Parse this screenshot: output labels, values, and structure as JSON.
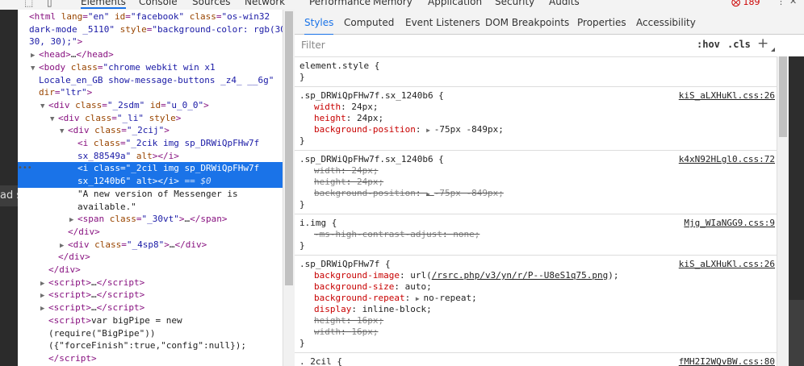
{
  "topbar": {
    "tabs": [
      "Elements",
      "Console",
      "Sources",
      "Network",
      "Performance",
      "Memory",
      "Application",
      "Security",
      "Audits"
    ],
    "active_tab": "Elements",
    "error_count": "189"
  },
  "behind_text": "ad s",
  "elements_tree": [
    {
      "indent": 0,
      "tri": "",
      "html": "<span class='tag'>&lt;html</span> <span class='an'>lang</span>=<span class='av'>\"en\"</span> <span class='an'>id</span>=<span class='av'>\"facebook\"</span> <span class='an'>class</span>=<span class='av'>\"os-win32</span>"
    },
    {
      "indent": 0,
      "tri": "",
      "html": "<span class='av'>dark-mode _5110\"</span> <span class='an'>style</span>=<span class='av'>\"background-color: rgb(30,</span>"
    },
    {
      "indent": 0,
      "tri": "",
      "html": "<span class='av'>30, 30);\"</span><span class='tag'>&gt;</span>"
    },
    {
      "indent": 1,
      "tri": "▶",
      "html": "<span class='tag'>&lt;head&gt;</span><span class='txt'>…</span><span class='tag'>&lt;/head&gt;</span>"
    },
    {
      "indent": 1,
      "tri": "▼",
      "html": "<span class='tag'>&lt;body</span> <span class='an'>class</span>=<span class='av'>\"chrome webkit win x1</span>"
    },
    {
      "indent": 1,
      "tri": "",
      "html": "<span class='av'>Locale_en_GB show-message-buttons _z4_ __6g\"</span>"
    },
    {
      "indent": 1,
      "tri": "",
      "html": "<span class='an'>dir</span>=<span class='av'>\"ltr\"</span><span class='tag'>&gt;</span>"
    },
    {
      "indent": 2,
      "tri": "▼",
      "html": "<span class='tag'>&lt;div</span> <span class='an'>class</span>=<span class='av'>\"_2sdm\"</span> <span class='an'>id</span>=<span class='av'>\"u_0_0\"</span><span class='tag'>&gt;</span>"
    },
    {
      "indent": 3,
      "tri": "▼",
      "html": "<span class='tag'>&lt;div</span> <span class='an'>class</span>=<span class='av'>\"_li\"</span> <span class='an'>style</span><span class='tag'>&gt;</span>"
    },
    {
      "indent": 4,
      "tri": "▼",
      "html": "<span class='tag'>&lt;div</span> <span class='an'>class</span>=<span class='av'>\"_2cij\"</span><span class='tag'>&gt;</span>"
    },
    {
      "indent": 5,
      "tri": "",
      "html": "<span class='tag'>&lt;i</span> <span class='an'>class</span>=<span class='av'>\"_2cik img sp_DRWiQpFHw7f</span>"
    },
    {
      "indent": 5,
      "tri": "",
      "html": "<span class='av'>sx_88549a\"</span> <span class='an'>alt</span><span class='tag'>&gt;&lt;/i&gt;</span>"
    },
    {
      "indent": 5,
      "tri": "",
      "selected": true,
      "html": "<span class='tag'>&lt;i</span> <span class='an'>class</span>=<span class='av'>\"_2cil img sp_DRWiQpFHw7f</span>"
    },
    {
      "indent": 5,
      "tri": "",
      "selected": true,
      "html": "<span class='av'>sx_1240b6\"</span> <span class='an'>alt</span><span class='tag'>&gt;&lt;/i&gt;</span> <span class='dollar'>== $0</span>"
    },
    {
      "indent": 5,
      "tri": "",
      "html": "<span class='txt'>\"A new version of Messenger is</span>"
    },
    {
      "indent": 5,
      "tri": "",
      "html": "<span class='txt'>available.\"</span>"
    },
    {
      "indent": 5,
      "tri": "▶",
      "html": "<span class='tag'>&lt;span</span> <span class='an'>class</span>=<span class='av'>\"_30vt\"</span><span class='tag'>&gt;</span><span class='txt'>…</span><span class='tag'>&lt;/span&gt;</span>"
    },
    {
      "indent": 4,
      "tri": "",
      "html": "<span class='tag'>&lt;/div&gt;</span>"
    },
    {
      "indent": 4,
      "tri": "▶",
      "html": "<span class='tag'>&lt;div</span> <span class='an'>class</span>=<span class='av'>\"_4sp8\"</span><span class='tag'>&gt;</span><span class='txt'>…</span><span class='tag'>&lt;/div&gt;</span>"
    },
    {
      "indent": 3,
      "tri": "",
      "html": "<span class='tag'>&lt;/div&gt;</span>"
    },
    {
      "indent": 2,
      "tri": "",
      "html": "<span class='tag'>&lt;/div&gt;</span>"
    },
    {
      "indent": 2,
      "tri": "▶",
      "html": "<span class='tag'>&lt;script&gt;</span><span class='txt'>…</span><span class='tag'>&lt;/script&gt;</span>"
    },
    {
      "indent": 2,
      "tri": "▶",
      "html": "<span class='tag'>&lt;script&gt;</span><span class='txt'>…</span><span class='tag'>&lt;/script&gt;</span>"
    },
    {
      "indent": 2,
      "tri": "▶",
      "html": "<span class='tag'>&lt;script&gt;</span><span class='txt'>…</span><span class='tag'>&lt;/script&gt;</span>"
    },
    {
      "indent": 2,
      "tri": "",
      "html": "<span class='tag'>&lt;script&gt;</span><span class='txt'>var bigPipe = new</span>"
    },
    {
      "indent": 2,
      "tri": "",
      "html": "<span class='txt'>(require(\"BigPipe\"))</span>"
    },
    {
      "indent": 2,
      "tri": "",
      "html": "<span class='txt'>({\"forceFinish\":true,\"config\":null});</span>"
    },
    {
      "indent": 2,
      "tri": "",
      "html": "<span class='tag'>&lt;/script&gt;</span>"
    }
  ],
  "styles_tabs": [
    "Styles",
    "Computed",
    "Event Listeners",
    "DOM Breakpoints",
    "Properties",
    "Accessibility"
  ],
  "active_styles_tab": "Styles",
  "filter": {
    "placeholder": "Filter",
    "hov": ":hov",
    "cls": ".cls",
    "plus": "+"
  },
  "rules": [
    {
      "selector": "element.style {",
      "source": "",
      "props": [],
      "close": "}"
    },
    {
      "selector": ".sp_DRWiQpFHw7f.sx_1240b6 {",
      "source": "kiS_aLXHuKl.css:26",
      "props": [
        {
          "name": "width",
          "value": "24px;",
          "strike": false,
          "tri": false
        },
        {
          "name": "height",
          "value": "24px;",
          "strike": false,
          "tri": false
        },
        {
          "name": "background-position",
          "value": "-75px -849px;",
          "strike": false,
          "tri": true
        }
      ],
      "close": "}"
    },
    {
      "selector": ".sp_DRWiQpFHw7f.sx_1240b6 {",
      "source": "k4xN92HLgl0.css:72",
      "props": [
        {
          "name": "width",
          "value": "24px;",
          "strike": true,
          "tri": false
        },
        {
          "name": "height",
          "value": "24px;",
          "strike": true,
          "tri": false
        },
        {
          "name": "background-position",
          "value": "-75px -849px;",
          "strike": true,
          "tri": true
        }
      ],
      "close": "}"
    },
    {
      "selector": "i.img {",
      "source": "Mjg_WIaNGG9.css:9",
      "props": [
        {
          "name": "-ms-high-contrast-adjust",
          "value": "none;",
          "strike": true,
          "tri": false
        }
      ],
      "close": "}"
    },
    {
      "selector": ".sp_DRWiQpFHw7f {",
      "source": "kiS_aLXHuKl.css:26",
      "props": [
        {
          "name": "background-image",
          "value": "url(",
          "link": "/rsrc.php/v3/yn/r/P--U8eS1q75.png",
          "after": ");",
          "strike": false,
          "tri": false
        },
        {
          "name": "background-size",
          "value": "auto;",
          "strike": false,
          "tri": false
        },
        {
          "name": "background-repeat",
          "value": "no-repeat;",
          "strike": false,
          "tri": true
        },
        {
          "name": "display",
          "value": "inline-block;",
          "strike": false,
          "tri": false
        },
        {
          "name": "height",
          "value": "16px;",
          "strike": true,
          "tri": false
        },
        {
          "name": "width",
          "value": "16px;",
          "strike": true,
          "tri": false
        }
      ],
      "close": "}"
    },
    {
      "selector": "._2cil {",
      "source": "fMH2I2WQvBW.css:80",
      "props": [],
      "close": ""
    }
  ]
}
